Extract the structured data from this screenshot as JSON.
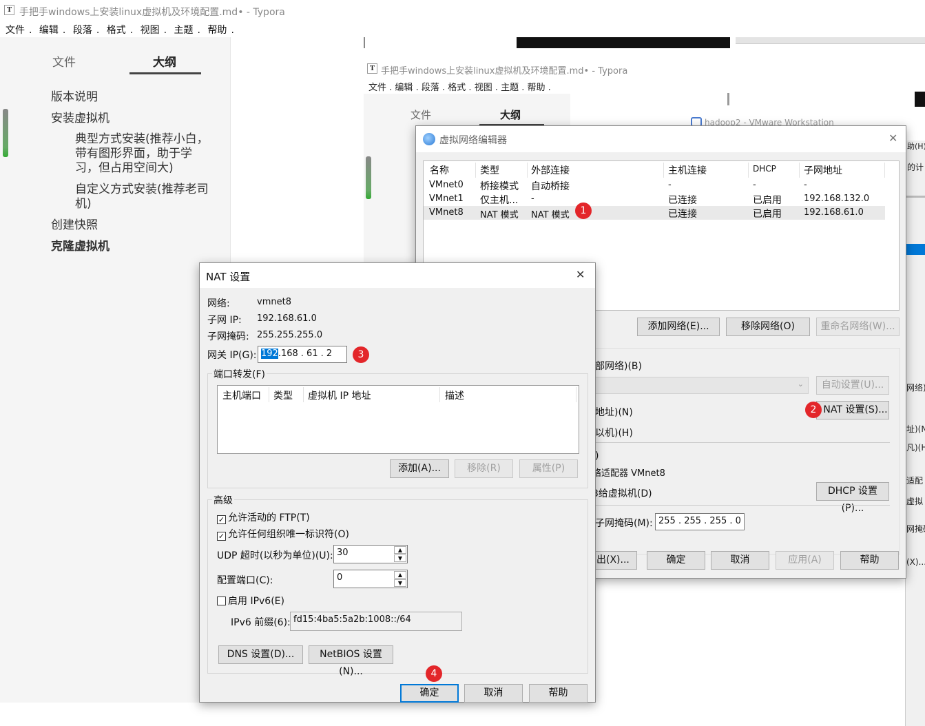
{
  "typora": {
    "title": "手把手windows上安装linux虚拟机及环境配置.md• - Typora",
    "icon_letter": "T",
    "menu": [
      "文件",
      "编辑",
      "段落",
      "格式",
      "视图",
      "主题",
      "帮助"
    ],
    "tabs": [
      "文件",
      "大纲"
    ],
    "outline": [
      "版本说明",
      "安装虚拟机",
      "典型方式安装(推荐小白，带有图形界面，助于学习，但占用空间大)",
      "自定义方式安装(推荐老司机)",
      "创建快照",
      "克隆虚拟机"
    ]
  },
  "vmware": {
    "title": "hadoop2 - VMware Workstation"
  },
  "vne": {
    "title": "虚拟网络编辑器",
    "headers": [
      "名称",
      "类型",
      "外部连接",
      "主机连接",
      "DHCP",
      "子网地址"
    ],
    "rows": [
      [
        "VMnet0",
        "桥接模式",
        "自动桥接",
        "-",
        "-",
        "-"
      ],
      [
        "VMnet1",
        "仅主机...",
        "-",
        "已连接",
        "已启用",
        "192.168.132.0"
      ],
      [
        "VMnet8",
        "NAT 模式",
        "NAT 模式",
        "已连接",
        "已启用",
        "192.168.61.0"
      ]
    ],
    "buttons": {
      "add": "添加网络(E)...",
      "remove": "移除网络(O)",
      "rename": "重命名网络(W)...",
      "auto": "自动设置(U)...",
      "nat": "NAT 设置(S)...",
      "dhcp": "DHCP 设置(P)...",
      "export": "出(X)...",
      "ok": "确定",
      "cancel": "取消",
      "apply": "应用(A)",
      "help": "帮助"
    },
    "labels": {
      "bridge": "部网络)(B)",
      "addr": "地址)(N)",
      "vm": "以机)(H)",
      "p1": ")",
      "adapter": "络适配器 VMnet8",
      "tovm": "3给虚拟机(D)",
      "mask": "子网掩码(M):"
    },
    "mask_value": "255 . 255 . 255 .  0"
  },
  "nat": {
    "title": "NAT 设置",
    "network_label": "网络:",
    "network": "vmnet8",
    "subnet_label": "子网 IP:",
    "subnet": "192.168.61.0",
    "mask_label": "子网掩码:",
    "mask": "255.255.255.0",
    "gw_label": "网关 IP(G):",
    "gw_parts": [
      "192",
      ".168",
      ". 61",
      ".  2"
    ],
    "pf_title": "端口转发(F)",
    "pf_headers": [
      "主机端口",
      "类型",
      "虚拟机 IP 地址",
      "描述"
    ],
    "pf_buttons": [
      "添加(A)...",
      "移除(R)",
      "属性(P)"
    ],
    "adv_title": "高级",
    "ftp": "允许活动的 FTP(T)",
    "oui": "允许任何组织唯一标识符(O)",
    "udp_label": "UDP 超时(以秒为单位)(U):",
    "udp": "30",
    "cfg_label": "配置端口(C):",
    "cfg": "0",
    "ipv6": "启用 IPv6(E)",
    "ipv6_prefix_label": "IPv6 前缀(6):",
    "ipv6_prefix": "fd15:4ba5:5a2b:1008::/64",
    "dns": "DNS 设置(D)...",
    "netbios": "NetBIOS 设置(N)...",
    "ok": "确定",
    "cancel": "取消",
    "help": "帮助"
  },
  "side_fragments": [
    "助(H)",
    "的计",
    "网络)",
    "址)(N",
    "凡)(H)",
    "适配",
    "虚拟",
    "网掩码",
    "(X)..."
  ],
  "badges": [
    "1",
    "2",
    "3",
    "4"
  ],
  "colors": {
    "badge": "#e3262a",
    "selection": "#0078d7"
  }
}
